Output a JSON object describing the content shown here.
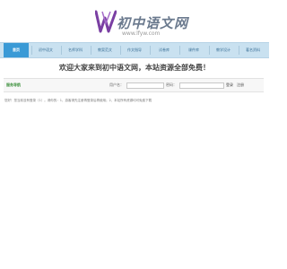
{
  "header": {
    "logo_text": "初中语文网",
    "logo_url": "www.lfyw.com",
    "logo_mark": "W"
  },
  "nav": {
    "items": [
      {
        "label": "首页"
      },
      {
        "label": "初中语文"
      },
      {
        "label": "名师学科"
      },
      {
        "label": "教案范文"
      },
      {
        "label": "作文指导"
      },
      {
        "label": "试卷库"
      },
      {
        "label": "课件库"
      },
      {
        "label": "教学设计"
      },
      {
        "label": "著名资料"
      }
    ],
    "active_index": 0
  },
  "welcome": {
    "text": "欢迎大家来到初中语文网，本站资源全部免费！"
  },
  "login": {
    "title": "服务导航",
    "username_label": "用户名：",
    "username_value": "",
    "password_label": "密码：",
    "password_value": "",
    "login_button": "登录",
    "register_button": "注册"
  },
  "notice": {
    "text": "您好！您当前没有登录（1）。请你的：1、游客请先注册再登录后再使用；2、本站所有资源均可免费下载"
  },
  "colors": {
    "nav_bg": "#c9e1f0",
    "nav_active": "#3a9ad6",
    "logo_mark": "#7a3fa3",
    "title_green": "#3a8f3a"
  }
}
